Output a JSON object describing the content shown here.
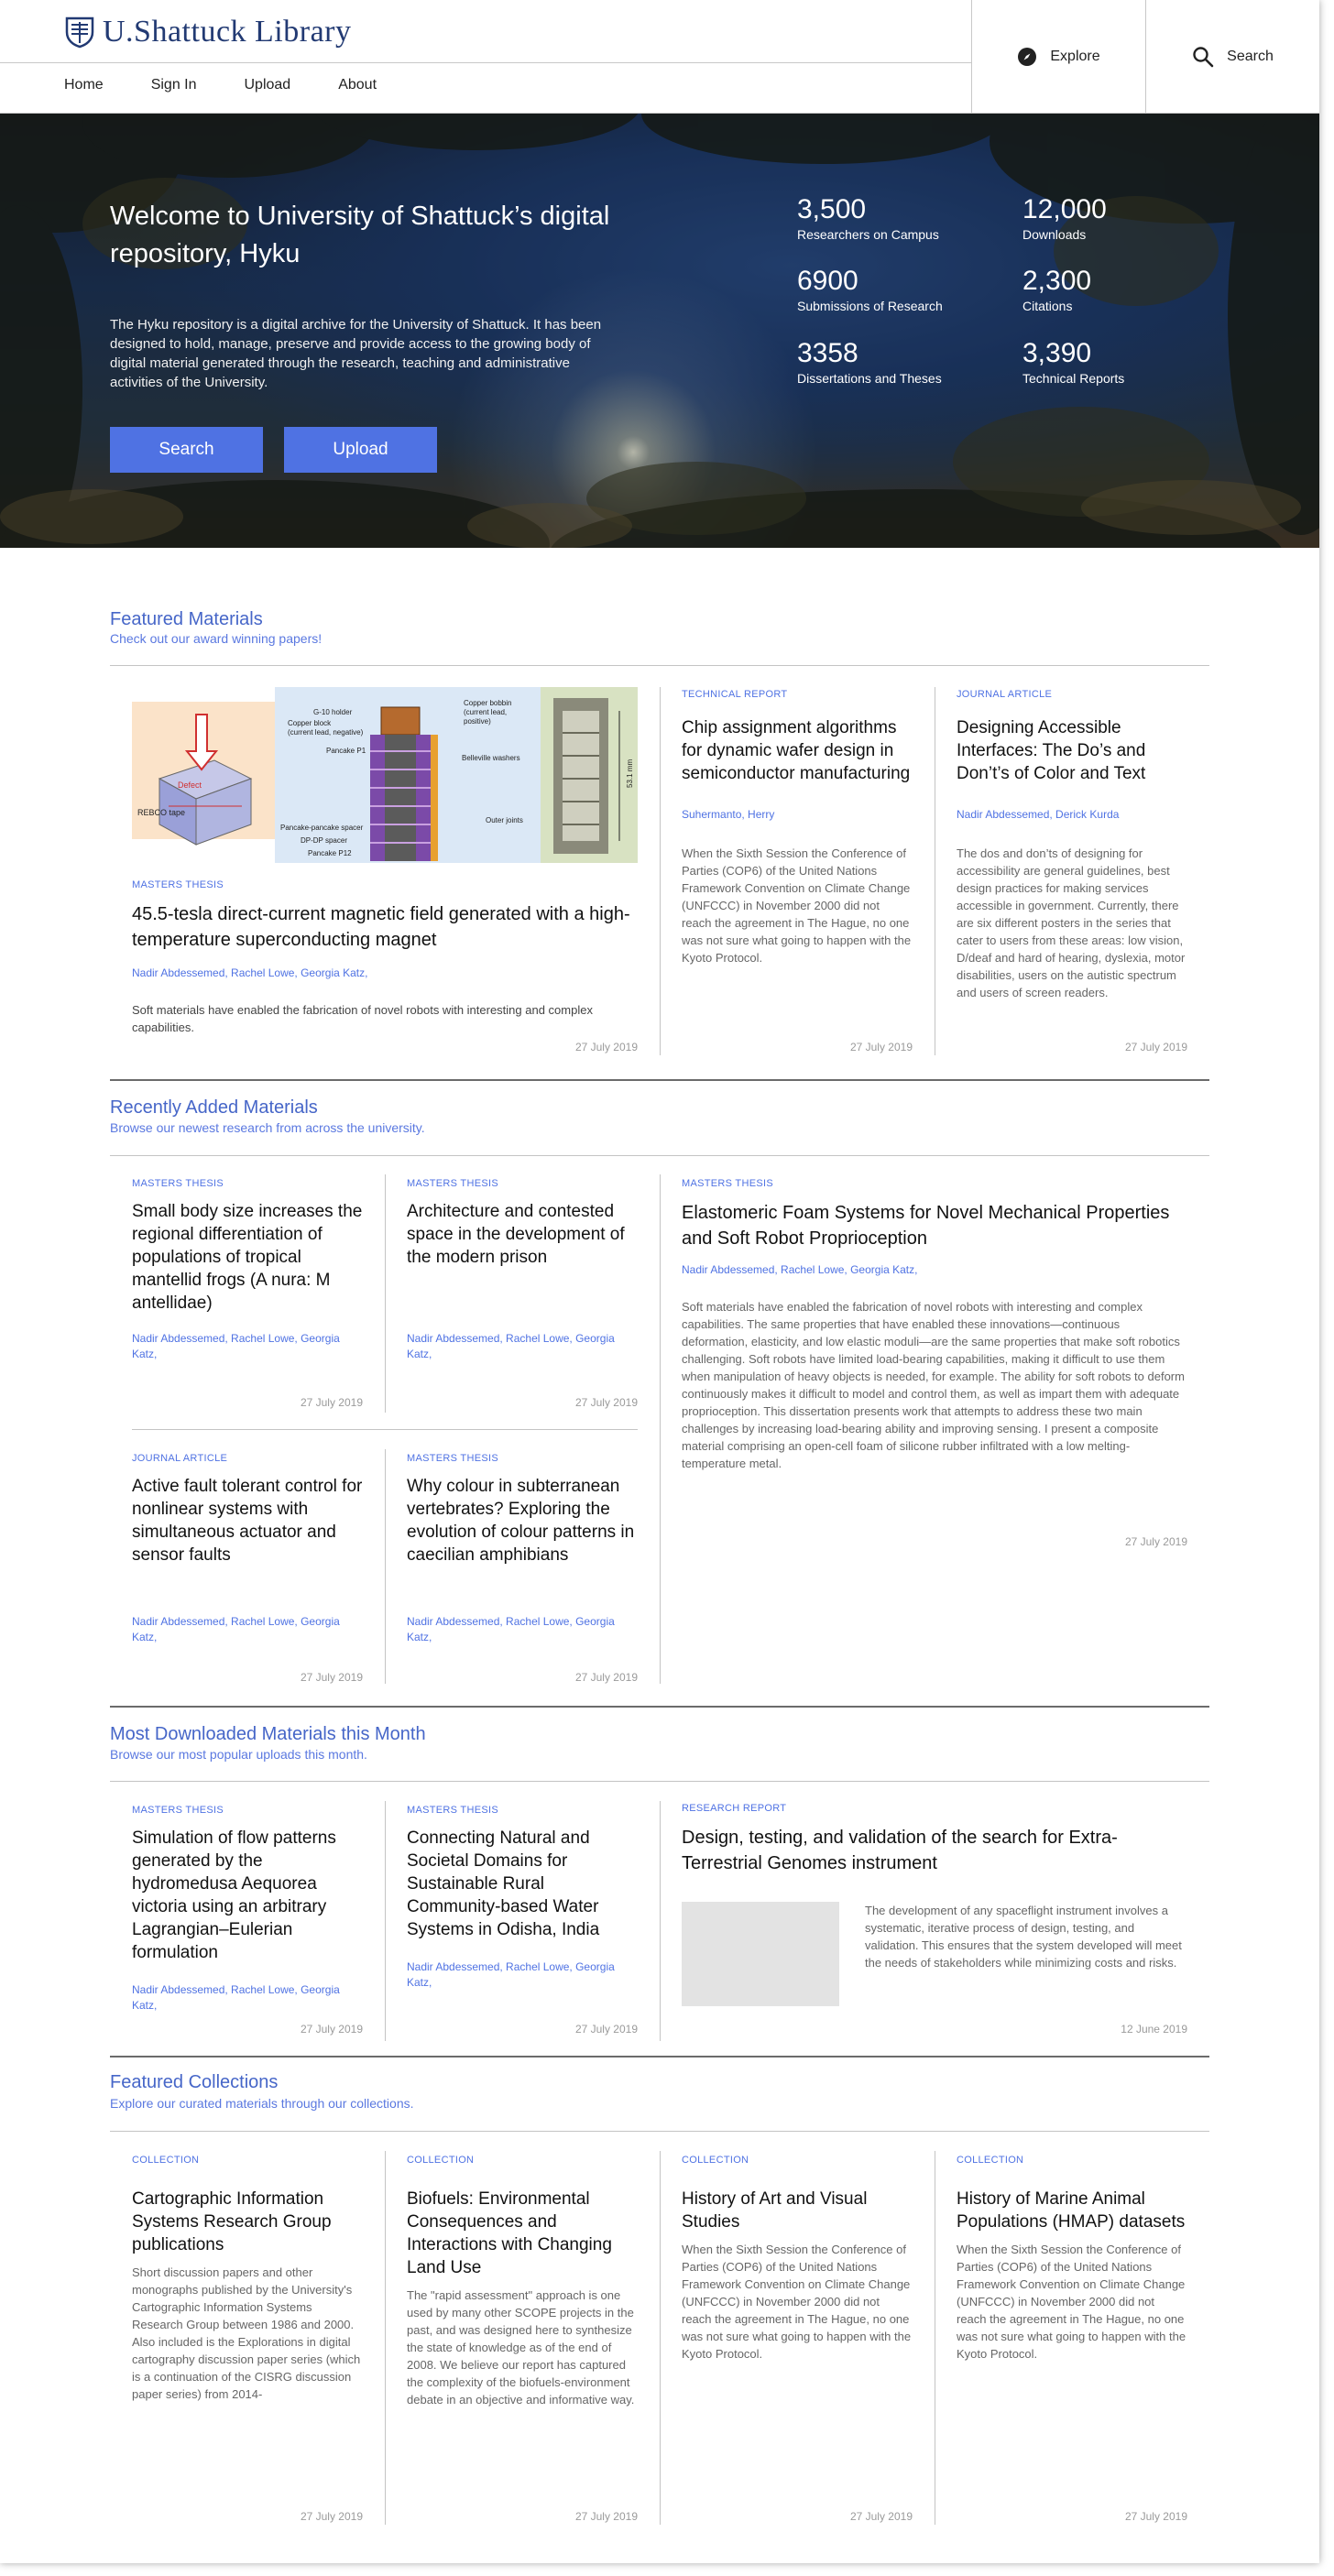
{
  "header": {
    "brand": "U.Shattuck Library",
    "nav": [
      "Home",
      "Sign In",
      "Upload",
      "About"
    ],
    "explore": "Explore",
    "search": "Search"
  },
  "hero": {
    "title": "Welcome to University of Shattuck’s digital repository, Hyku",
    "description": "The Hyku repository is a digital archive for the University of Shattuck. It has been designed to hold, manage, preserve and provide access to the growing body of digital material generated through the research, teaching and administrative activities of the University.",
    "search_button": "Search",
    "upload_button": "Upload",
    "stats": [
      {
        "value": "3,500",
        "label": "Researchers on Campus"
      },
      {
        "value": "12,000",
        "label": "Downloads"
      },
      {
        "value": "6900",
        "label": "Submissions of Research"
      },
      {
        "value": "2,300",
        "label": "Citations"
      },
      {
        "value": "3358",
        "label": "Dissertations and Theses"
      },
      {
        "value": "3,390",
        "label": "Technical Reports"
      }
    ]
  },
  "featured": {
    "title": "Featured Materials",
    "subtitle": "Check out our award winning papers!",
    "main": {
      "type": "MASTERS THESIS",
      "title": "45.5-tesla direct-current magnetic field generated with a high-temperature superconducting magnet",
      "authors": "Nadir Abdessemed, Rachel Lowe, Georgia Katz,",
      "desc": "Soft materials have enabled the fabrication of novel robots with interesting and complex capabilities.",
      "date": "27 July 2019",
      "figure_labels": [
        "G-10 holder",
        "Copper block",
        "(current lead, negative)",
        "Copper bobbin",
        "(current lead,",
        "positive)",
        "Pancake P1",
        "Belleville washers",
        "REBCO tape",
        "Defect",
        "Pancake-pancake spacer",
        "DP-DP spacer",
        "Pancake P12",
        "Outer joints",
        "53.1 mm"
      ]
    },
    "side": [
      {
        "type": "TECHNICAL REPORT",
        "title": "Chip assignment algorithms for dynamic wafer design in semiconductor manufacturing",
        "authors": "Suhermanto, Herry",
        "desc": "When the Sixth Session the Conference of Parties (COP6) of the United Nations Framework Convention on Climate Change (UNFCCC) in November 2000 did not reach the agreement in The Hague, no one was not sure what going to happen with the Kyoto Protocol.",
        "date": "27 July 2019"
      },
      {
        "type": "JOURNAL ARTICLE",
        "title": "Designing Accessible Interfaces: The Do’s and Don’t’s of Color and Text",
        "authors": "Nadir Abdessemed, Derick Kurda",
        "desc": "The dos and don’ts of designing for accessibility are general guidelines, best design practices for making services accessible in government. Currently, there are six different posters in the series that cater to users from these areas: low vision, D/deaf and hard of hearing, dyslexia, motor disabilities, users on the autistic spectrum and users of screen readers.",
        "date": "27 July 2019"
      }
    ]
  },
  "recent": {
    "title": "Recently Added Materials",
    "subtitle": "Browse our newest research from across the university.",
    "cards": [
      {
        "type": "MASTERS THESIS",
        "title": "Small body size increases the regional differentiation of populations of tropical mantellid frogs (A nura: M antellidae)",
        "authors": "Nadir Abdessemed, Rachel Lowe, Georgia Katz,",
        "date": "27 July 2019"
      },
      {
        "type": "MASTERS THESIS",
        "title": "Architecture and contested space in the development of the modern prison",
        "authors": "Nadir Abdessemed, Rachel Lowe, Georgia Katz,",
        "date": "27 July 2019"
      },
      {
        "type": "JOURNAL ARTICLE",
        "title": "Active fault tolerant control for nonlinear systems with simultaneous actuator and sensor faults",
        "authors": "Nadir Abdessemed, Rachel Lowe, Georgia Katz,",
        "date": "27 July 2019"
      },
      {
        "type": "MASTERS THESIS",
        "title": "Why colour in subterranean vertebrates? Exploring the evolution of colour patterns in caecilian amphibians",
        "authors": "Nadir Abdessemed, Rachel Lowe, Georgia Katz,",
        "date": "27 July 2019"
      }
    ],
    "wide": {
      "type": "MASTERS THESIS",
      "title": "Elastomeric Foam Systems for Novel Mechanical Properties and Soft Robot Proprioception",
      "authors": "Nadir Abdessemed, Rachel Lowe, Georgia Katz,",
      "desc": "Soft materials have enabled the fabrication of novel robots with interesting and complex capabilities. The same properties that have enabled these innovations—continuous deformation, elasticity, and low elastic moduli—are the same properties that make soft robotics challenging. Soft robots have limited load-bearing capabilities, making it difficult to use them when manipulation of heavy objects is needed, for example. The ability for soft robots to deform continuously makes it difficult to model and control them, as well as impart them with adequate proprioception. This dissertation presents work that attempts to address these two main challenges by increasing load-bearing ability and improving sensing. I present a composite material comprising an open-cell foam of silicone rubber infiltrated with a low melting-temperature metal.",
      "date": "27 July 2019"
    }
  },
  "downloaded": {
    "title": "Most Downloaded Materials this Month",
    "subtitle": "Browse our most popular uploads this month.",
    "cards": [
      {
        "type": "MASTERS THESIS",
        "title": "Simulation of flow patterns generated by the hydromedusa Aequorea victoria using an arbitrary Lagrangian–Eulerian formulation",
        "authors": "Nadir Abdessemed, Rachel Lowe, Georgia Katz,",
        "date": "27 July 2019"
      },
      {
        "type": "MASTERS THESIS",
        "title": "Connecting Natural and Societal Domains for Sustainable Rural Community-based Water Systems in Odisha, India",
        "authors": "Nadir Abdessemed, Rachel Lowe, Georgia Katz,",
        "date": "27 July 2019"
      }
    ],
    "wide": {
      "type": "RESEARCH REPORT",
      "title": "Design, testing, and validation of the search for Extra-Terrestrial Genomes instrument",
      "desc": "The development of any spaceflight instrument involves a systematic, iterative process of design, testing, and validation. This ensures that the system developed will meet the needs of stakeholders while minimizing costs and risks.",
      "date": "12 June 2019"
    }
  },
  "collections": {
    "title": "Featured Collections",
    "subtitle": "Explore our curated materials through our collections.",
    "cards": [
      {
        "type": "COLLECTION",
        "title": "Cartographic Information Systems Research Group publications",
        "desc": "Short discussion papers and other monographs published by the University's Cartographic Information Systems Research Group between 1986 and 2000. Also included is the Explorations in digital cartography discussion paper series (which is a continuation of the CISRG discussion paper series) from 2014-",
        "date": "27 July 2019"
      },
      {
        "type": "COLLECTION",
        "title": "Biofuels: Environmental Consequences and Interactions with Changing Land Use",
        "desc": "The \"rapid assessment\" approach is one used by many other SCOPE projects in the past, and was designed here to synthesize the state of knowledge as of the end of 2008. We believe our report has captured the complexity of the biofuels-environment debate in an objective and informative way.",
        "date": "27 July 2019"
      },
      {
        "type": "COLLECTION",
        "title": "History of Art and Visual Studies",
        "desc": "When the Sixth Session the Conference of Parties (COP6) of the United Nations Framework Convention on Climate Change (UNFCCC) in November 2000 did not reach the agreement in The Hague, no one was not sure what going to happen with the Kyoto Protocol.",
        "date": "27 July 2019"
      },
      {
        "type": "COLLECTION",
        "title": "History of Marine Animal Populations (HMAP) datasets",
        "desc": "When the Sixth Session the Conference of Parties (COP6) of the United Nations Framework Convention on Climate Change (UNFCCC) in November 2000 did not reach the agreement in The Hague, no one was not sure what going to happen with the Kyoto Protocol.",
        "date": "27 July 2019"
      }
    ]
  }
}
